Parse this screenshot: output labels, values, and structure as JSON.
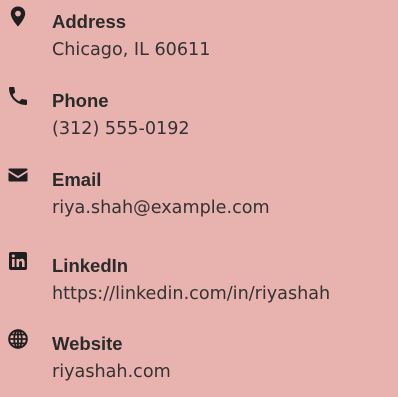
{
  "colors": {
    "background": "#e8b2ae",
    "text": "#2b2b2b",
    "icon": "#1f1f1f"
  },
  "contact": {
    "address": {
      "icon": "map-marker-icon",
      "label": "Address",
      "value": "Chicago, IL 60611"
    },
    "phone": {
      "icon": "phone-icon",
      "label": "Phone",
      "value": "(312) 555-0192"
    },
    "email": {
      "icon": "envelope-icon",
      "label": "Email",
      "value": "riya.shah@example.com"
    },
    "linkedin": {
      "icon": "linkedin-icon",
      "label": "LinkedIn",
      "value": "https://linkedin.com/in/riyashah"
    },
    "website": {
      "icon": "globe-icon",
      "label": "Website",
      "value": "riyashah.com"
    }
  }
}
